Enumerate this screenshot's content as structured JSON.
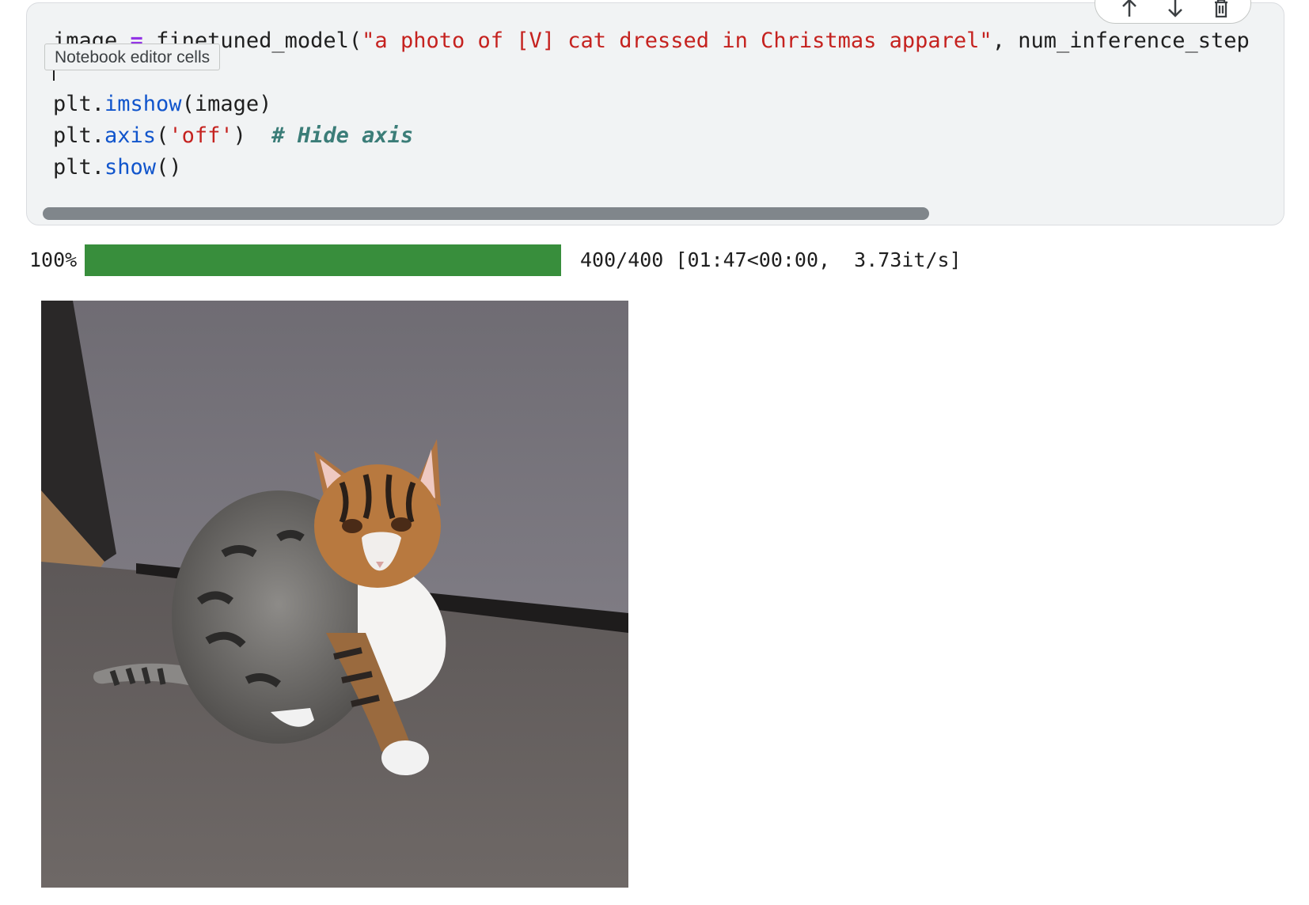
{
  "code_cell": {
    "line1": {
      "var": "image",
      "op": "=",
      "call": "finetuned_model(",
      "prompt": "\"a photo of [V] cat dressed in Christmas apparel\"",
      "rest": ", num_inference_step"
    },
    "line3": {
      "obj": "plt.",
      "fn": "imshow",
      "args": "(image)"
    },
    "line4": {
      "obj": "plt.",
      "fn": "axis",
      "open": "(",
      "arg": "'off'",
      "close": ")",
      "comment": "# Hide axis"
    },
    "line5": {
      "obj": "plt.",
      "fn": "show",
      "args": "()"
    }
  },
  "tooltip": {
    "text": "Notebook editor cells"
  },
  "toolbar": {
    "icons": [
      "move-up-icon",
      "move-down-icon",
      "delete-icon"
    ]
  },
  "progress": {
    "percent_label": "100%",
    "fraction": 1.0,
    "stats": "400/400 [01:47<00:00,  3.73it/s]"
  },
  "output": {
    "image_alt": "generated cat image"
  },
  "colors": {
    "string": "#c5221f",
    "function": "#1155cc",
    "comment": "#3b7d78",
    "progress_fill": "#388e3c"
  }
}
